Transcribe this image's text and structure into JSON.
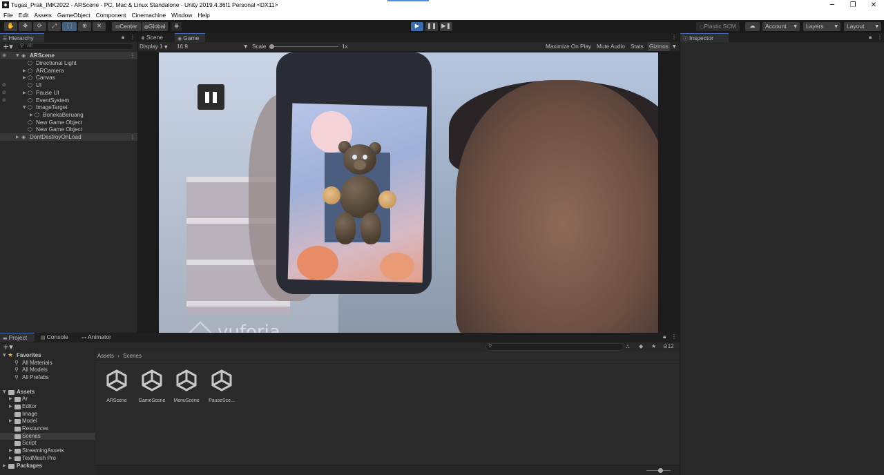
{
  "window": {
    "title": "Tugas_Prak_IMK2022 - ARScene - PC, Mac & Linux Standalone - Unity 2019.4.36f1 Personal <DX11>",
    "controls": {
      "minimize": "─",
      "restore": "❐",
      "close": "✕"
    }
  },
  "menu": [
    "File",
    "Edit",
    "Assets",
    "GameObject",
    "Component",
    "Cinemachine",
    "Window",
    "Help"
  ],
  "toolbar": {
    "tools": [
      "hand-tool-icon",
      "move-tool-icon",
      "rotate-tool-icon",
      "scale-tool-icon",
      "rect-tool-icon",
      "transform-tool-icon",
      "custom-tool-icon"
    ],
    "pivot": "Center",
    "space": "Global",
    "plastic_scm": "Plastic SCM",
    "account": "Account",
    "layers": "Layers",
    "layout": "Layout"
  },
  "hierarchy": {
    "tab": "Hierarchy",
    "search_placeholder": "All",
    "scene_name": "ARScene",
    "items": [
      {
        "label": "Directional Light"
      },
      {
        "label": "ARCamera"
      },
      {
        "label": "Canvas"
      },
      {
        "label": "UI"
      },
      {
        "label": "Pause UI"
      },
      {
        "label": "EventSystem"
      },
      {
        "label": "ImageTarget"
      },
      {
        "label": "BonekaBeruang"
      },
      {
        "label": "New Game Object"
      },
      {
        "label": "New Game Object"
      }
    ],
    "dont_destroy": "DontDestroyOnLoad"
  },
  "game_view": {
    "tabs": [
      "Scene",
      "Game"
    ],
    "display": "Display 1",
    "aspect": "16:9",
    "scale_label": "Scale",
    "scale_value": "1x",
    "scale_level": 0.0,
    "options": [
      "Maximize On Play",
      "Mute Audio",
      "Stats",
      "Gizmos"
    ],
    "watermark": "vuforia"
  },
  "inspector": {
    "tab": "Inspector"
  },
  "project": {
    "tabs": [
      "Project",
      "Console",
      "Animator"
    ],
    "hidden_count": "12",
    "breadcrumb": [
      "Assets",
      "Scenes"
    ],
    "favorites": {
      "label": "Favorites",
      "items": [
        "All Materials",
        "All Models",
        "All Prefabs"
      ]
    },
    "assets": {
      "label": "Assets",
      "folders": [
        "Ar",
        "Editor",
        "Image",
        "Model",
        "Resources",
        "Scenes",
        "Script",
        "StreamingAssets",
        "TextMesh Pro"
      ]
    },
    "packages": "Packages",
    "scenes": [
      "ARScene",
      "GameScene",
      "MenuScene",
      "PauseSce..."
    ]
  },
  "colors": {
    "accent": "#3d6ab0",
    "play_button": "#3a6aa8",
    "favorite_star": "#e2b23a"
  }
}
